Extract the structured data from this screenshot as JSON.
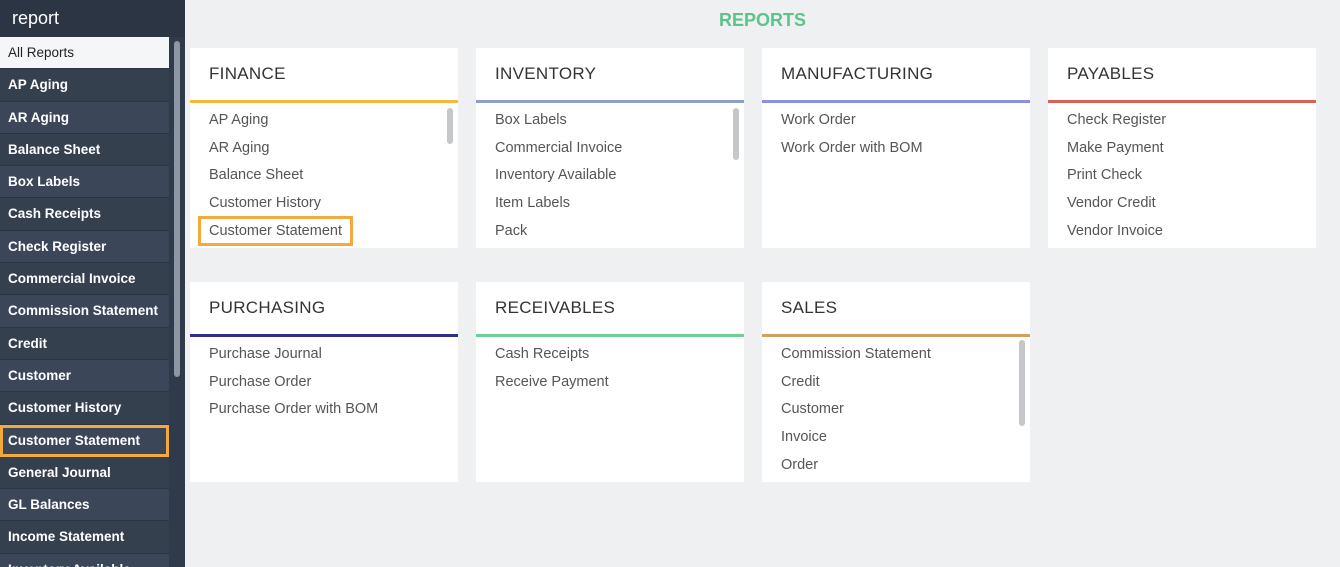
{
  "sidebar": {
    "title": "report",
    "items": [
      {
        "label": "All Reports"
      },
      {
        "label": "AP Aging"
      },
      {
        "label": "AR Aging"
      },
      {
        "label": "Balance Sheet"
      },
      {
        "label": "Box Labels"
      },
      {
        "label": "Cash Receipts"
      },
      {
        "label": "Check Register"
      },
      {
        "label": "Commercial Invoice"
      },
      {
        "label": "Commission Statement"
      },
      {
        "label": "Credit"
      },
      {
        "label": "Customer"
      },
      {
        "label": "Customer History"
      },
      {
        "label": "Customer Statement"
      },
      {
        "label": "General Journal"
      },
      {
        "label": "GL Balances"
      },
      {
        "label": "Income Statement"
      },
      {
        "label": "Inventory Available"
      }
    ]
  },
  "main": {
    "title": "REPORTS",
    "cards": [
      {
        "title": "FINANCE",
        "color": "#f5b942",
        "items": [
          "AP Aging",
          "AR Aging",
          "Balance Sheet",
          "Customer History",
          "Customer Statement"
        ]
      },
      {
        "title": "INVENTORY",
        "color": "#8e9ec4",
        "items": [
          "Box Labels",
          "Commercial Invoice",
          "Inventory Available",
          "Item Labels",
          "Pack"
        ]
      },
      {
        "title": "MANUFACTURING",
        "color": "#8c8fe0",
        "items": [
          "Work Order",
          "Work Order with BOM"
        ]
      },
      {
        "title": "PAYABLES",
        "color": "#d9605a",
        "items": [
          "Check Register",
          "Make Payment",
          "Print Check",
          "Vendor Credit",
          "Vendor Invoice"
        ]
      },
      {
        "title": "PURCHASING",
        "color": "#2e2f8a",
        "items": [
          "Purchase Journal",
          "Purchase Order",
          "Purchase Order with BOM"
        ]
      },
      {
        "title": "RECEIVABLES",
        "color": "#6fcf98",
        "items": [
          "Cash Receipts",
          "Receive Payment"
        ]
      },
      {
        "title": "SALES",
        "color": "#d0a060",
        "items": [
          "Commission Statement",
          "Credit",
          "Customer",
          "Invoice",
          "Order"
        ]
      }
    ]
  },
  "colors": {
    "accent": "#5cc48a",
    "highlight": "#f3a93c",
    "sidebar_bg": "#2f3a4b"
  }
}
